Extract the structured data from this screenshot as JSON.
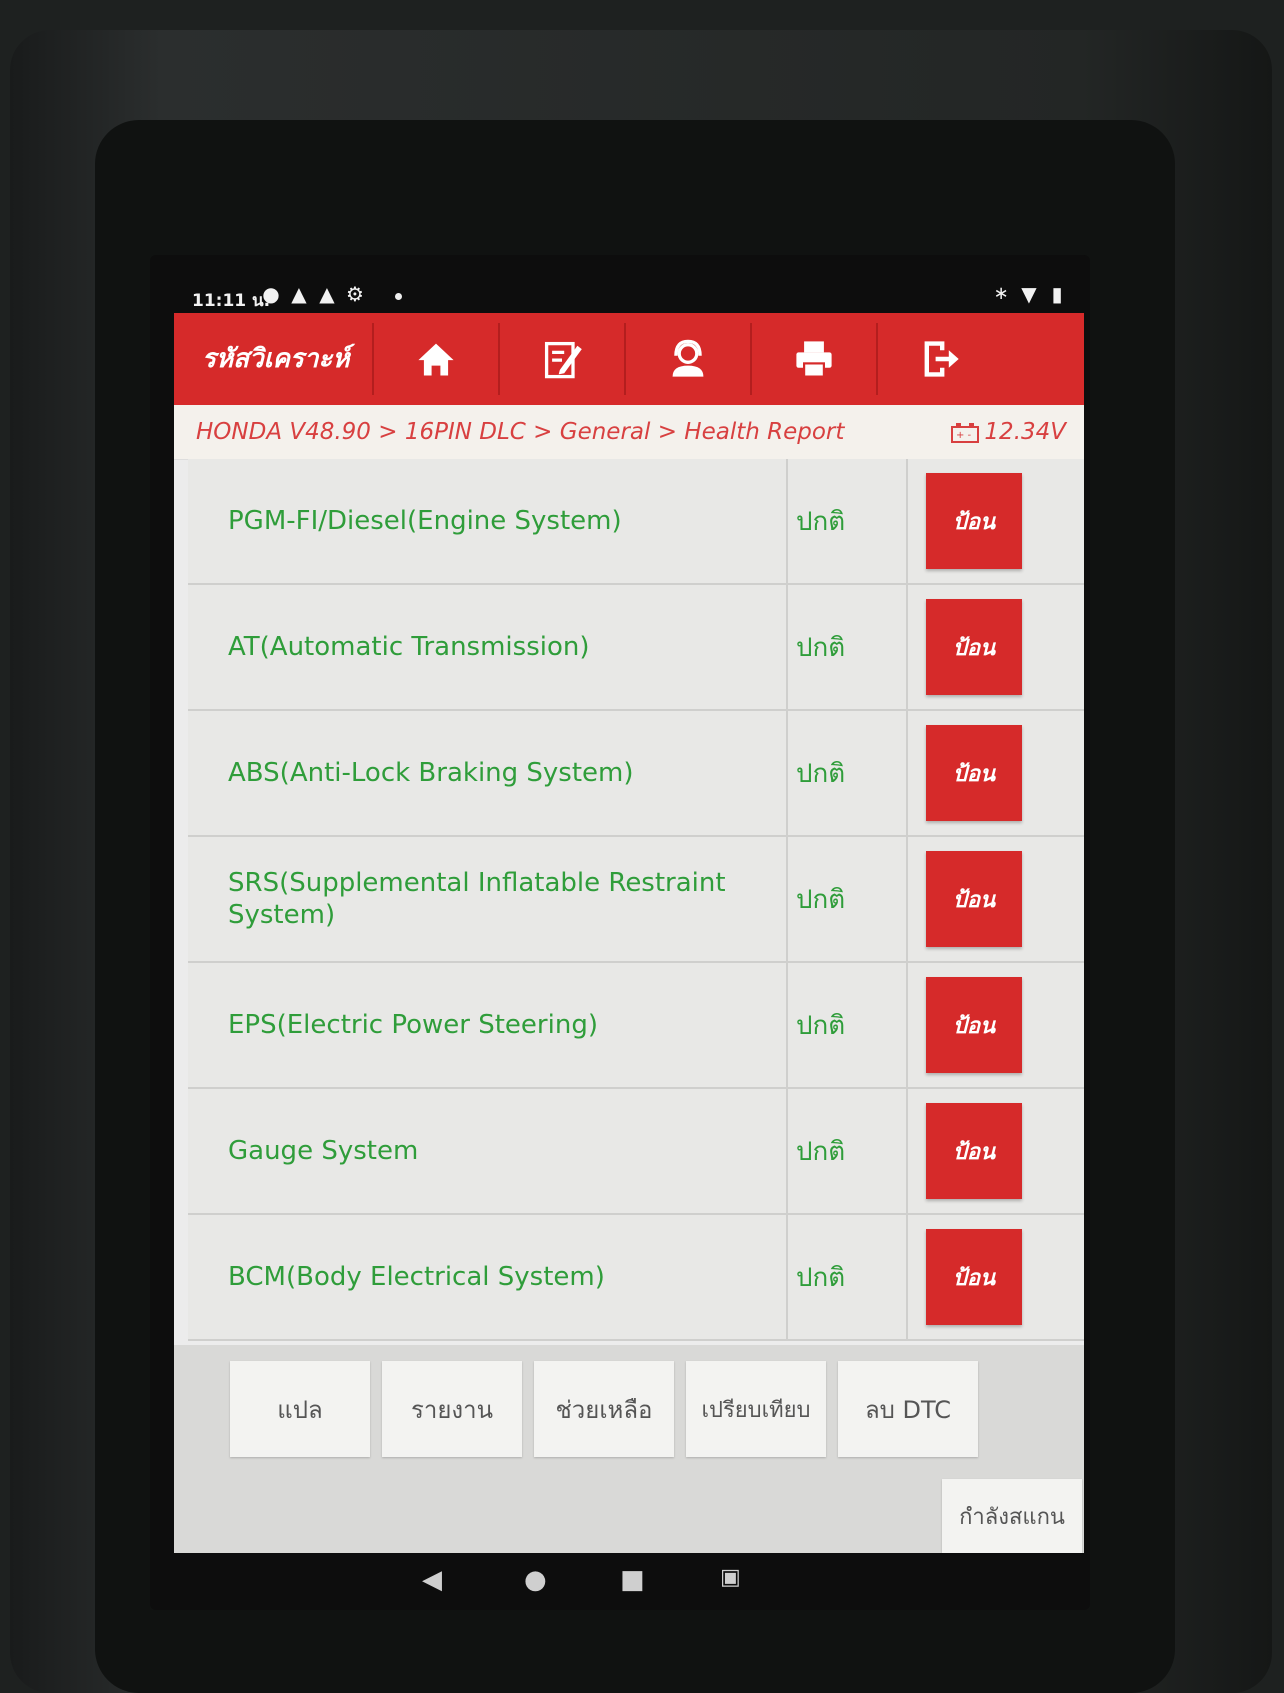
{
  "statusbar": {
    "time": "11:11 น.",
    "icons": [
      "info-circle-icon",
      "warning-icon",
      "warning-icon",
      "settings-icon"
    ],
    "right_icons": [
      "bluetooth-icon",
      "wifi-icon",
      "battery-icon"
    ]
  },
  "header": {
    "title": "รหัสวิเคราะห์",
    "nav": [
      "home-icon",
      "edit-icon",
      "support-icon",
      "print-icon",
      "exit-icon"
    ]
  },
  "breadcrumb": {
    "path": "HONDA V48.90 > 16PIN DLC > General > Health Report",
    "voltage": "12.34V"
  },
  "systems": [
    {
      "name": "PGM-FI/Diesel(Engine System)",
      "status": "ปกติ",
      "action": "ป้อน"
    },
    {
      "name": "AT(Automatic Transmission)",
      "status": "ปกติ",
      "action": "ป้อน"
    },
    {
      "name": "ABS(Anti-Lock Braking System)",
      "status": "ปกติ",
      "action": "ป้อน"
    },
    {
      "name": "SRS(Supplemental Inflatable Restraint System)",
      "status": "ปกติ",
      "action": "ป้อน"
    },
    {
      "name": "EPS(Electric Power Steering)",
      "status": "ปกติ",
      "action": "ป้อน"
    },
    {
      "name": "Gauge System",
      "status": "ปกติ",
      "action": "ป้อน"
    },
    {
      "name": "BCM(Body Electrical System)",
      "status": "ปกติ",
      "action": "ป้อน"
    }
  ],
  "bottom_buttons": [
    "แปล",
    "รายงาน",
    "ช่วยเหลือ",
    "เปรียบเทียบ",
    "ลบ DTC"
  ],
  "scan_button": "กำลังสแกน",
  "colors": {
    "accent": "#d62a2a",
    "ok_text": "#2f9d3a",
    "breadcrumb": "#d84040"
  }
}
